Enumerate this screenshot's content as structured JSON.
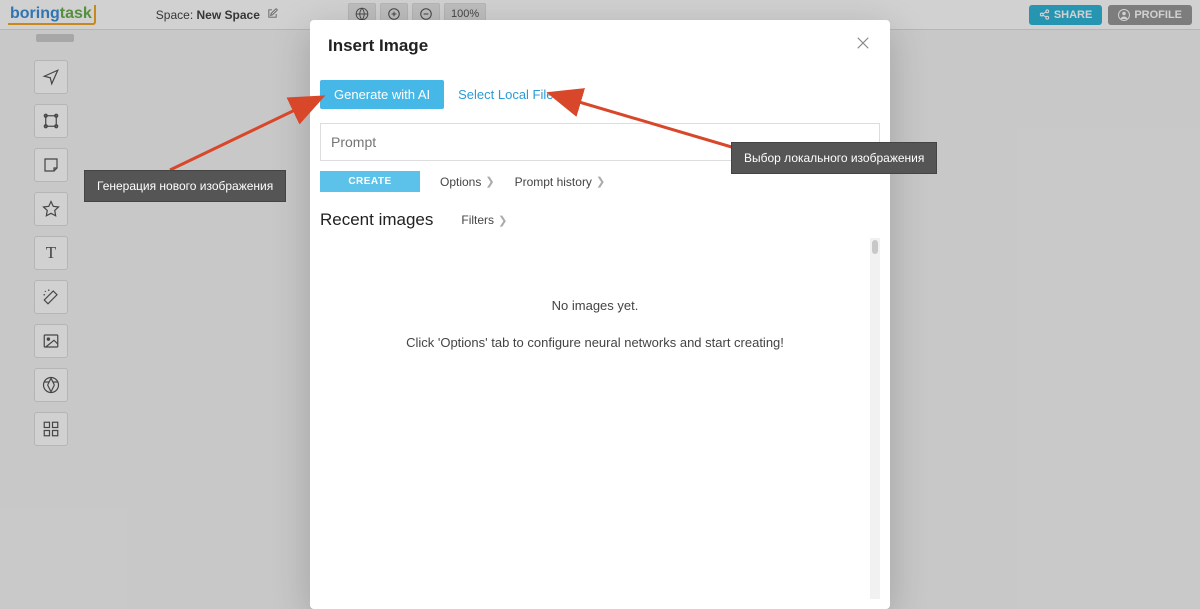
{
  "logo": {
    "part1": "boring",
    "part2": "task"
  },
  "topbar": {
    "space_label": "Space:",
    "space_name": "New Space",
    "zoom": "100%",
    "share": "SHARE",
    "profile": "PROFILE"
  },
  "modal": {
    "title": "Insert Image",
    "tab_generate": "Generate with AI",
    "tab_select_local": "Select Local File",
    "prompt_placeholder": "Prompt",
    "create": "CREATE",
    "options": "Options",
    "history": "Prompt history",
    "recent_title": "Recent images",
    "filters": "Filters",
    "empty_msg1": "No images yet.",
    "empty_msg2": "Click 'Options' tab to configure neural networks and start creating!"
  },
  "callouts": {
    "generate": "Генерация нового изображения",
    "select_local": "Выбор локального изображения"
  }
}
